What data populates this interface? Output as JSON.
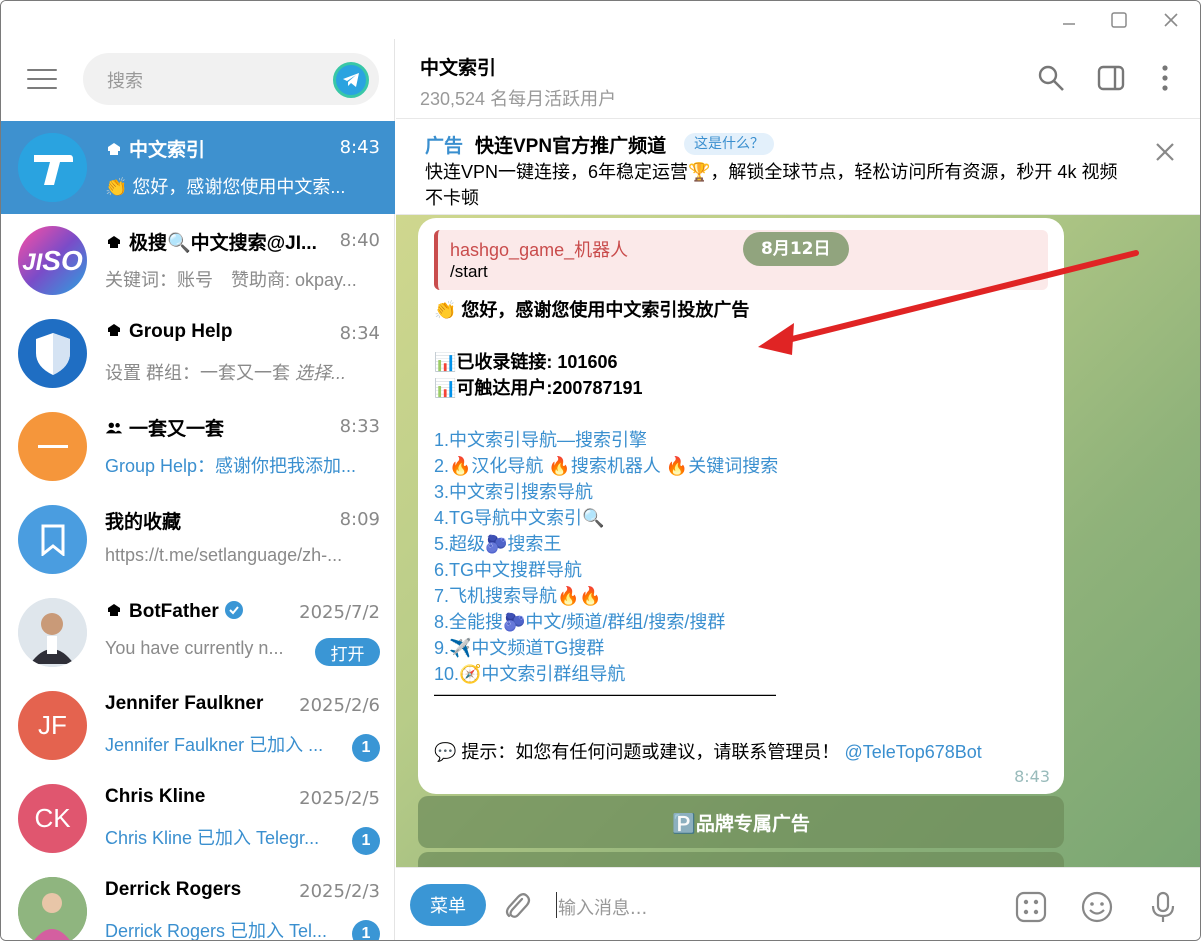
{
  "window": {
    "minimize_icon": "minimize-icon",
    "maximize_icon": "maximize-icon",
    "close_icon": "close-icon"
  },
  "sidebar": {
    "search_placeholder": "搜索",
    "chats": [
      {
        "name": "中文索引",
        "time": "8:43",
        "preview": "👏 您好，感谢您使用中文索...",
        "avatar_color": "#2aa3e0"
      },
      {
        "name": "极搜🔍中文搜索@JI...",
        "time": "8:40",
        "preview": "关键词：账号　赞助商: okpay...",
        "avatar_color": "#7a4cc8"
      },
      {
        "name": "Group Help",
        "time": "8:34",
        "preview": "设置 群组：一套又一套",
        "preview_extra": "选择...",
        "avatar_color": "#1f6ec3"
      },
      {
        "name": "一套又一套",
        "time": "8:33",
        "preview": "Group Help：感谢你把我添加...",
        "avatar_color": "#f5963b"
      },
      {
        "name": "我的收藏",
        "time": "8:09",
        "preview": "https://t.me/setlanguage/zh-...",
        "avatar_color": "#4a9de0"
      },
      {
        "name": "BotFather",
        "time": "2025/7/2",
        "preview": "You have currently n...",
        "action": "打开",
        "avatar_color": "#7a9bb5"
      },
      {
        "name": "Jennifer Faulkner",
        "time": "2025/2/6",
        "preview": "Jennifer Faulkner 已加入 ...",
        "badge": "1",
        "initials": "JF",
        "avatar_color": "#e4634f"
      },
      {
        "name": "Chris Kline",
        "time": "2025/2/5",
        "preview": "Chris Kline 已加入 Telegr...",
        "badge": "1",
        "initials": "CK",
        "avatar_color": "#e0566f"
      },
      {
        "name": "Derrick Rogers",
        "time": "2025/2/3",
        "preview": "Derrick Rogers 已加入 Tel...",
        "badge": "1",
        "avatar_color": "#7aa36b"
      }
    ]
  },
  "header": {
    "title": "中文索引",
    "subtitle": "230,524 名每月活跃用户"
  },
  "ad": {
    "label": "广告",
    "title": "快连VPN官方推广频道",
    "what": "这是什么？",
    "text": "快连VPN一键连接，6年稳定运营🏆，解锁全球节点，轻松访问所有资源，秒开 4k 视频不卡顿"
  },
  "chat": {
    "date": "8月12日",
    "reply_name": "hashgo_game_机器人",
    "reply_text": "/start",
    "greeting": "👏 您好，感谢您使用中文索引投放广告",
    "stat1": "📊已收录链接: 101606",
    "stat2": "📊可触达用户:200787191",
    "links": [
      "1.中文索引导航—搜索引擎",
      "2.🔥汉化导航 🔥搜索机器人 🔥关键词搜索",
      "3.中文索引搜索导航",
      "4.TG导航中文索引🔍",
      "5.超级🫐搜索王",
      "6.TG中文搜群导航",
      "7.飞机搜索导航🔥🔥",
      "8.全能搜🫐中文/频道/群组/搜索/搜群",
      "9.✈️中文频道TG搜群",
      "10.🧭中文索引群组导航"
    ],
    "divider": "———————————————————",
    "tip": "💬 提示：如您有任何问题或建议，请联系管理员！",
    "tip_link": "@TeleTop678Bot",
    "time": "8:43",
    "button1": "🅿️品牌专属广告",
    "button2": "📢..."
  },
  "composer": {
    "menu_label": "菜单",
    "placeholder": "输入消息..."
  }
}
